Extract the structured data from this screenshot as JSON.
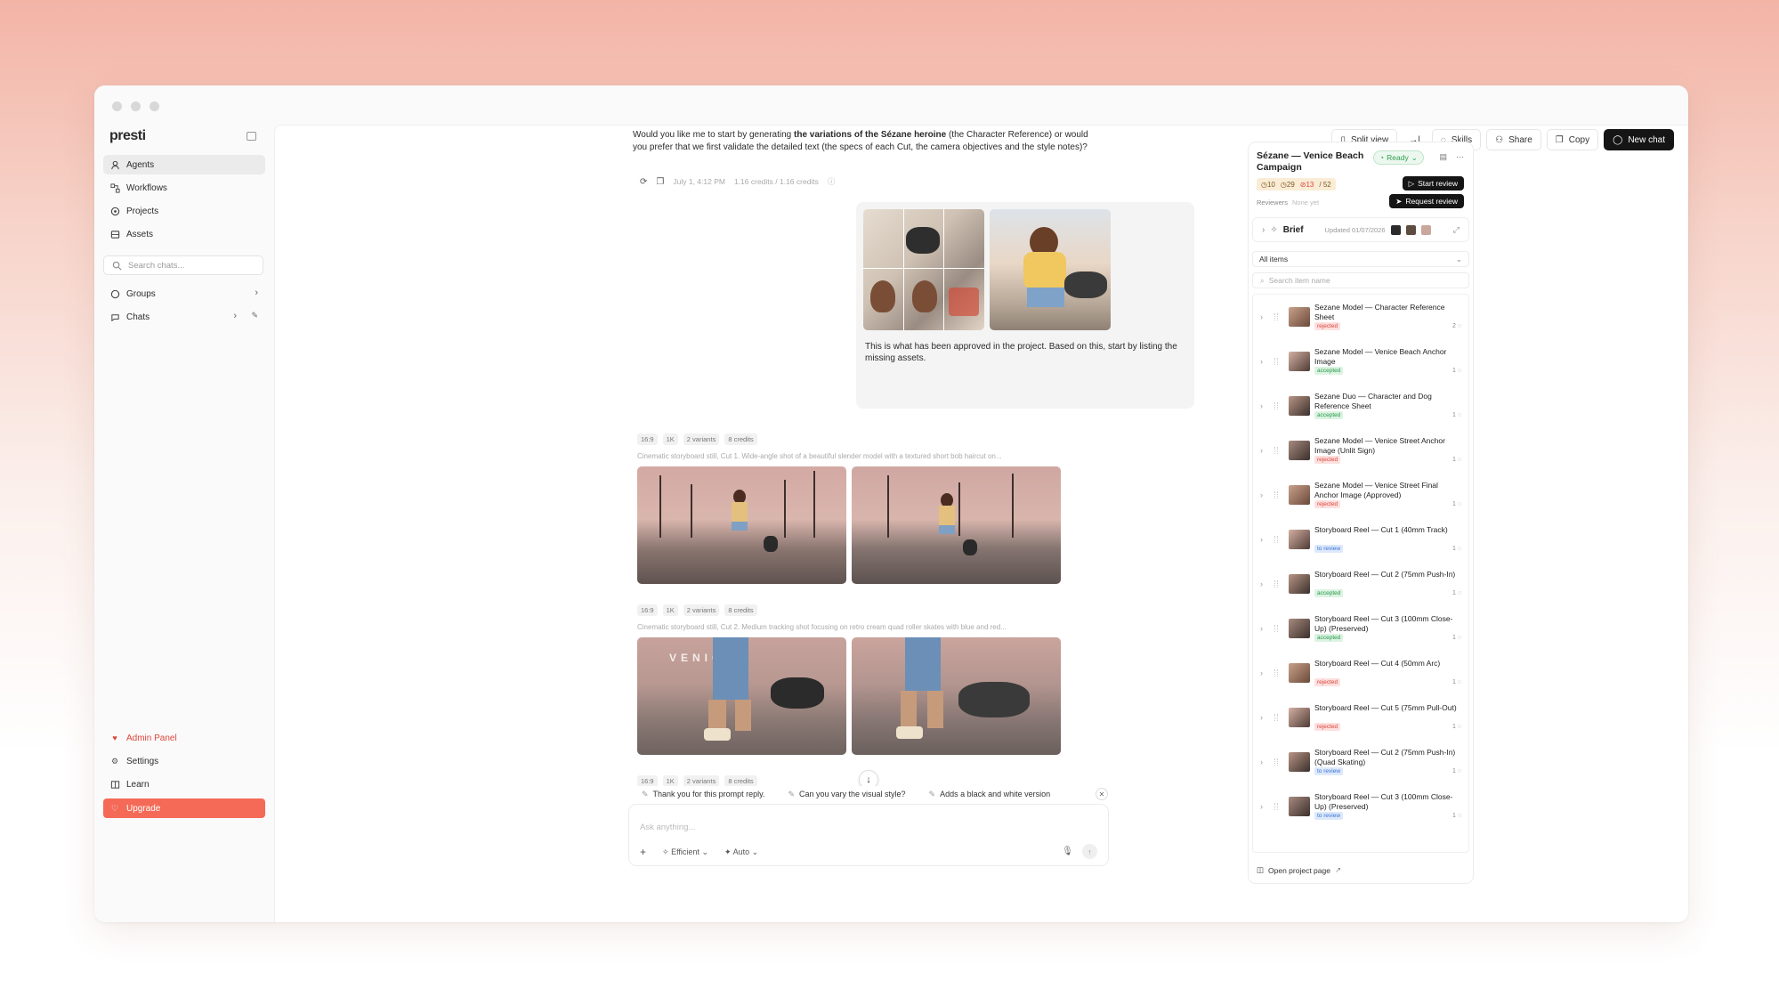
{
  "app": {
    "logo": "presti"
  },
  "sidebar": {
    "items": [
      {
        "label": "Agents",
        "icon": "agent-icon"
      },
      {
        "label": "Workflows",
        "icon": "workflow-icon"
      },
      {
        "label": "Projects",
        "icon": "projects-icon"
      },
      {
        "label": "Assets",
        "icon": "assets-icon"
      }
    ],
    "search_placeholder": "Search chats...",
    "groups_label": "Groups",
    "chats_label": "Chats",
    "bottom": {
      "admin": "Admin Panel",
      "settings": "Settings",
      "learn": "Learn",
      "upgrade": "Upgrade"
    }
  },
  "topbar": {
    "split_view": "Split view",
    "skills": "Skills",
    "share": "Share",
    "copy": "Copy",
    "new_chat": "New chat"
  },
  "chat": {
    "assistant_text_1": "Would you like me to start by generating ",
    "assistant_text_bold": "the variations of the Sézane heroine",
    "assistant_text_2": " (the Character Reference) or would you prefer that we first validate the detailed text (the specs of each Cut, the camera objectives and the style notes)?",
    "timestamp": "July 1, 4:12 PM",
    "credits": "1.16 credits / 1.16 credits",
    "user_caption": "This is what has been approved in the project. Based on this, start by listing the missing assets.",
    "generations": [
      {
        "tags": [
          "16:9",
          "1K",
          "2 variants",
          "8 credits"
        ],
        "prompt": "Cinematic storyboard still, Cut 1. Wide-angle shot of a beautiful slender model with a textured short bob haircut on..."
      },
      {
        "tags": [
          "16:9",
          "1K",
          "2 variants",
          "8 credits"
        ],
        "prompt": "Cinematic storyboard still, Cut 2. Medium tracking shot focusing on retro cream quad roller skates with blue and red..."
      },
      {
        "tags": [
          "16:9",
          "1K",
          "2 variants",
          "8 credits"
        ]
      }
    ],
    "venice_sign": "VENICE"
  },
  "suggestions": [
    "Thank you for this prompt reply.",
    "Can you vary the visual style?",
    "Adds a black and white version"
  ],
  "composer": {
    "placeholder": "Ask anything...",
    "mode": "Efficient",
    "model": "Auto"
  },
  "panel": {
    "title": "Sézane — Venice Beach Campaign",
    "status": "Ready",
    "stats": {
      "a": "10",
      "b": "29",
      "c": "13",
      "total": "52"
    },
    "start_review": "Start review",
    "request_review": "Request review",
    "reviewers_label": "Reviewers",
    "reviewers_value": "None yet",
    "brief_label": "Brief",
    "brief_updated": "Updated 01/07/2026",
    "filter": "All items",
    "search_placeholder": "Search item name",
    "items": [
      {
        "name": "Sezane Model — Character Reference Sheet",
        "status": "rejected",
        "count": "2"
      },
      {
        "name": "Sezane Model — Venice Beach Anchor Image",
        "status": "accepted",
        "count": "1"
      },
      {
        "name": "Sezane Duo — Character and Dog Reference Sheet",
        "status": "accepted",
        "count": "1"
      },
      {
        "name": "Sezane Model — Venice Street Anchor Image (Unlit Sign)",
        "status": "rejected",
        "count": "1"
      },
      {
        "name": "Sezane Model — Venice Street Final Anchor Image (Approved)",
        "status": "rejected",
        "count": "1"
      },
      {
        "name": "Storyboard Reel — Cut 1 (40mm Track)",
        "status": "to review",
        "count": "1"
      },
      {
        "name": "Storyboard Reel — Cut 2 (75mm Push-In)",
        "status": "accepted",
        "count": "1"
      },
      {
        "name": "Storyboard Reel — Cut 3 (100mm Close-Up) (Preserved)",
        "status": "accepted",
        "count": "1"
      },
      {
        "name": "Storyboard Reel — Cut 4 (50mm Arc)",
        "status": "rejected",
        "count": "1"
      },
      {
        "name": "Storyboard Reel — Cut 5 (75mm Pull-Out)",
        "status": "rejected",
        "count": "1"
      },
      {
        "name": "Storyboard Reel — Cut 2 (75mm Push-In) (Quad Skating)",
        "status": "to review",
        "count": "1"
      },
      {
        "name": "Storyboard Reel — Cut 3 (100mm Close-Up) (Preserved)",
        "status": "to review",
        "count": "1"
      }
    ],
    "open_page": "Open project page"
  }
}
